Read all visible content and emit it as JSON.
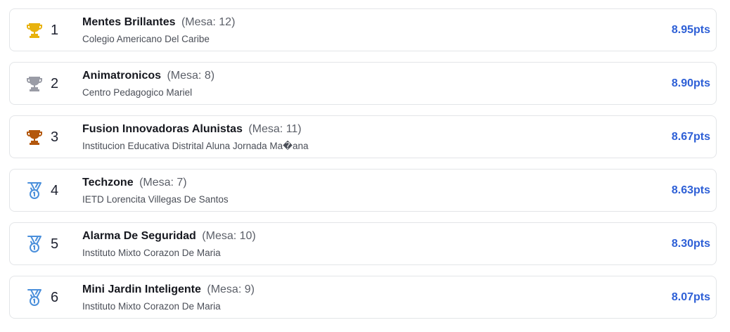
{
  "ranking": [
    {
      "rank": "1",
      "team": "Mentes Brillantes",
      "mesa": "(Mesa: 12)",
      "school": "Colegio Americano Del Caribe",
      "score": "8.95pts",
      "icon": "trophy-gold-icon",
      "icon_color": "#e8b20d"
    },
    {
      "rank": "2",
      "team": "Animatronicos",
      "mesa": "(Mesa: 8)",
      "school": "Centro Pedagogico Mariel",
      "score": "8.90pts",
      "icon": "trophy-silver-icon",
      "icon_color": "#9a9ca6"
    },
    {
      "rank": "3",
      "team": "Fusion Innovadoras Alunistas",
      "mesa": "(Mesa: 11)",
      "school": "Institucion Educativa Distrital Aluna Jornada Ma�ana",
      "score": "8.67pts",
      "icon": "trophy-bronze-icon",
      "icon_color": "#b3570c"
    },
    {
      "rank": "4",
      "team": "Techzone",
      "mesa": "(Mesa: 7)",
      "school": "IETD Lorencita Villegas De Santos",
      "score": "8.63pts",
      "icon": "medal-icon",
      "icon_color": "#4a8fdb"
    },
    {
      "rank": "5",
      "team": "Alarma De Seguridad",
      "mesa": "(Mesa: 10)",
      "school": "Instituto Mixto Corazon De Maria",
      "score": "8.30pts",
      "icon": "medal-icon",
      "icon_color": "#4a8fdb"
    },
    {
      "rank": "6",
      "team": "Mini Jardin Inteligente",
      "mesa": "(Mesa: 9)",
      "school": "Instituto Mixto Corazon De Maria",
      "score": "8.07pts",
      "icon": "medal-icon",
      "icon_color": "#4a8fdb"
    }
  ],
  "colors": {
    "score": "#2d5fd6",
    "border": "#e3e5e8"
  }
}
